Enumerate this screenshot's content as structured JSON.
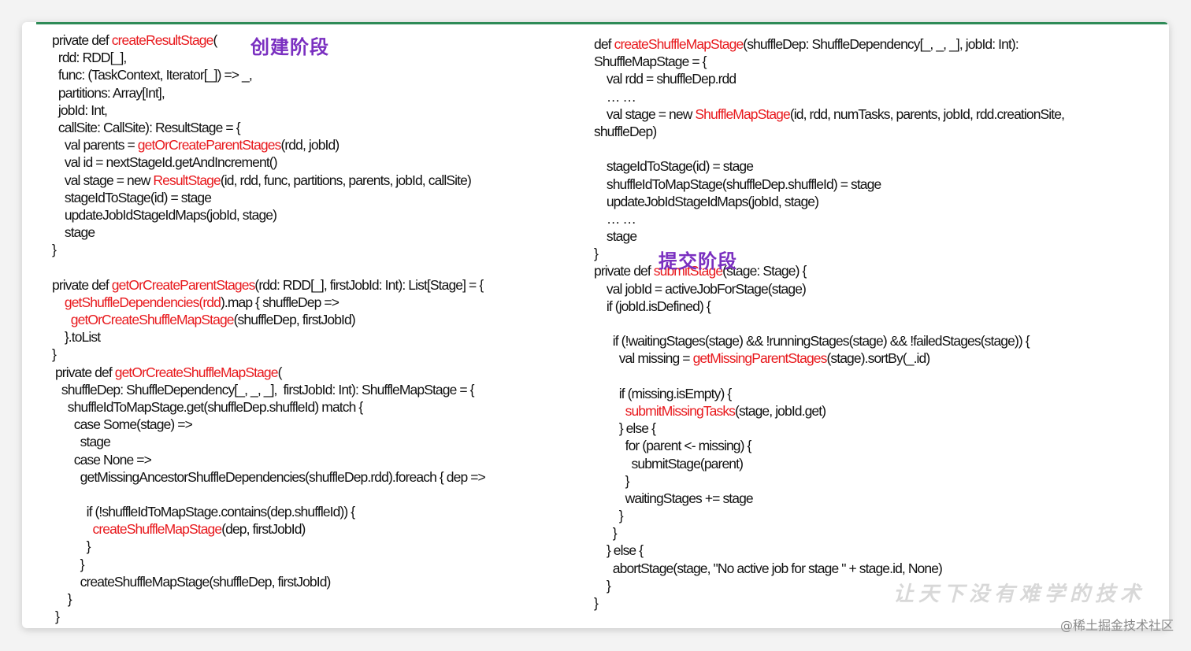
{
  "labels": {
    "create_stage": "创建阶段",
    "submit_stage": "提交阶段"
  },
  "left_code": [
    [
      {
        "t": "private def "
      },
      {
        "t": "createResultStage",
        "h": 1
      },
      {
        "t": "("
      }
    ],
    [
      {
        "t": "  rdd: RDD[_],"
      }
    ],
    [
      {
        "t": "  func: (TaskContext, Iterator[_]) => _,"
      }
    ],
    [
      {
        "t": "  partitions: Array[Int],"
      }
    ],
    [
      {
        "t": "  jobId: Int,"
      }
    ],
    [
      {
        "t": "  callSite: CallSite): ResultStage = {"
      }
    ],
    [
      {
        "t": "    val parents = "
      },
      {
        "t": "getOrCreateParentStages",
        "h": 1
      },
      {
        "t": "(rdd, jobId)"
      }
    ],
    [
      {
        "t": "    val id = nextStageId.getAndIncrement()"
      }
    ],
    [
      {
        "t": "    val stage = new "
      },
      {
        "t": "ResultStage",
        "h": 1
      },
      {
        "t": "(id, rdd, func, partitions, parents, jobId, callSite)"
      }
    ],
    [
      {
        "t": "    stageIdToStage(id) = stage"
      }
    ],
    [
      {
        "t": "    updateJobIdStageIdMaps(jobId, stage)"
      }
    ],
    [
      {
        "t": "    stage"
      }
    ],
    [
      {
        "t": "}"
      }
    ],
    [
      {
        "t": ""
      }
    ],
    [
      {
        "t": "private def "
      },
      {
        "t": "getOrCreateParentStages",
        "h": 1
      },
      {
        "t": "(rdd: RDD[_], firstJobId: Int): List[Stage] = {"
      }
    ],
    [
      {
        "t": "    "
      },
      {
        "t": "getShuffleDependencies(rdd",
        "h": 1
      },
      {
        "t": ").map { shuffleDep =>"
      }
    ],
    [
      {
        "t": "      "
      },
      {
        "t": "getOrCreateShuffleMapStage",
        "h": 1
      },
      {
        "t": "(shuffleDep, firstJobId)"
      }
    ],
    [
      {
        "t": "    }.toList"
      }
    ],
    [
      {
        "t": "}"
      }
    ],
    [
      {
        "t": " private def "
      },
      {
        "t": "getOrCreateShuffleMapStage",
        "h": 1
      },
      {
        "t": "("
      }
    ],
    [
      {
        "t": "   shuffleDep: ShuffleDependency[_, _, _],  firstJobId: Int): ShuffleMapStage = {"
      }
    ],
    [
      {
        "t": "     shuffleIdToMapStage.get(shuffleDep.shuffleId) match {"
      }
    ],
    [
      {
        "t": "       case Some(stage) =>"
      }
    ],
    [
      {
        "t": "         stage"
      }
    ],
    [
      {
        "t": "       case None =>"
      }
    ],
    [
      {
        "t": "         getMissingAncestorShuffleDependencies(shuffleDep.rdd).foreach { dep =>"
      }
    ],
    [
      {
        "t": ""
      }
    ],
    [
      {
        "t": "           if (!shuffleIdToMapStage.contains(dep.shuffleId)) {"
      }
    ],
    [
      {
        "t": "             "
      },
      {
        "t": "createShuffleMapStage",
        "h": 1
      },
      {
        "t": "(dep, firstJobId)"
      }
    ],
    [
      {
        "t": "           }"
      }
    ],
    [
      {
        "t": "         }"
      }
    ],
    [
      {
        "t": "         createShuffleMapStage(shuffleDep, firstJobId)"
      }
    ],
    [
      {
        "t": "     }"
      }
    ],
    [
      {
        "t": " }"
      }
    ]
  ],
  "right_code": [
    [
      {
        "t": "def "
      },
      {
        "t": "createShuffleMapStage",
        "h": 1
      },
      {
        "t": "(shuffleDep: ShuffleDependency[_, _, _], jobId: Int):"
      }
    ],
    [
      {
        "t": "ShuffleMapStage = {"
      }
    ],
    [
      {
        "t": "    val rdd = shuffleDep.rdd"
      }
    ],
    [
      {
        "t": "    … …"
      }
    ],
    [
      {
        "t": "    val stage = new "
      },
      {
        "t": "ShuffleMapStage",
        "h": 1
      },
      {
        "t": "(id, rdd, numTasks, parents, jobId, rdd.creationSite,"
      }
    ],
    [
      {
        "t": "shuffleDep)"
      }
    ],
    [
      {
        "t": ""
      }
    ],
    [
      {
        "t": "    stageIdToStage(id) = stage"
      }
    ],
    [
      {
        "t": "    shuffleIdToMapStage(shuffleDep.shuffleId) = stage"
      }
    ],
    [
      {
        "t": "    updateJobIdStageIdMaps(jobId, stage)"
      }
    ],
    [
      {
        "t": "    … …"
      }
    ],
    [
      {
        "t": "    stage"
      }
    ],
    [
      {
        "t": "}"
      }
    ],
    [
      {
        "t": "private def "
      },
      {
        "t": "submitStage",
        "h": 1
      },
      {
        "t": "(stage: Stage) {"
      }
    ],
    [
      {
        "t": "    val jobId = activeJobForStage(stage)"
      }
    ],
    [
      {
        "t": "    if (jobId.isDefined) {"
      }
    ],
    [
      {
        "t": ""
      }
    ],
    [
      {
        "t": "      if (!waitingStages(stage) && !runningStages(stage) && !failedStages(stage)) {"
      }
    ],
    [
      {
        "t": "        val missing = "
      },
      {
        "t": "getMissingParentStages",
        "h": 1
      },
      {
        "t": "(stage).sortBy(_.id)"
      }
    ],
    [
      {
        "t": ""
      }
    ],
    [
      {
        "t": "        if (missing.isEmpty) {"
      }
    ],
    [
      {
        "t": "          "
      },
      {
        "t": "submitMissingTasks",
        "h": 1
      },
      {
        "t": "(stage, jobId.get)"
      }
    ],
    [
      {
        "t": "        } else {"
      }
    ],
    [
      {
        "t": "          for (parent <- missing) {"
      }
    ],
    [
      {
        "t": "            submitStage(parent)"
      }
    ],
    [
      {
        "t": "          }"
      }
    ],
    [
      {
        "t": "          waitingStages += stage"
      }
    ],
    [
      {
        "t": "        }"
      }
    ],
    [
      {
        "t": "      }"
      }
    ],
    [
      {
        "t": "    } else {"
      }
    ],
    [
      {
        "t": "      abortStage(stage, \"No active job for stage \" + stage.id, None)"
      }
    ],
    [
      {
        "t": "    }"
      }
    ],
    [
      {
        "t": "}"
      }
    ]
  ],
  "watermark": "让天下没有难学的技术",
  "footer": "@稀土掘金技术社区",
  "colors": {
    "highlight": "#e8191d",
    "label": "#7a2fc0",
    "accent_line": "#2e8b57"
  }
}
